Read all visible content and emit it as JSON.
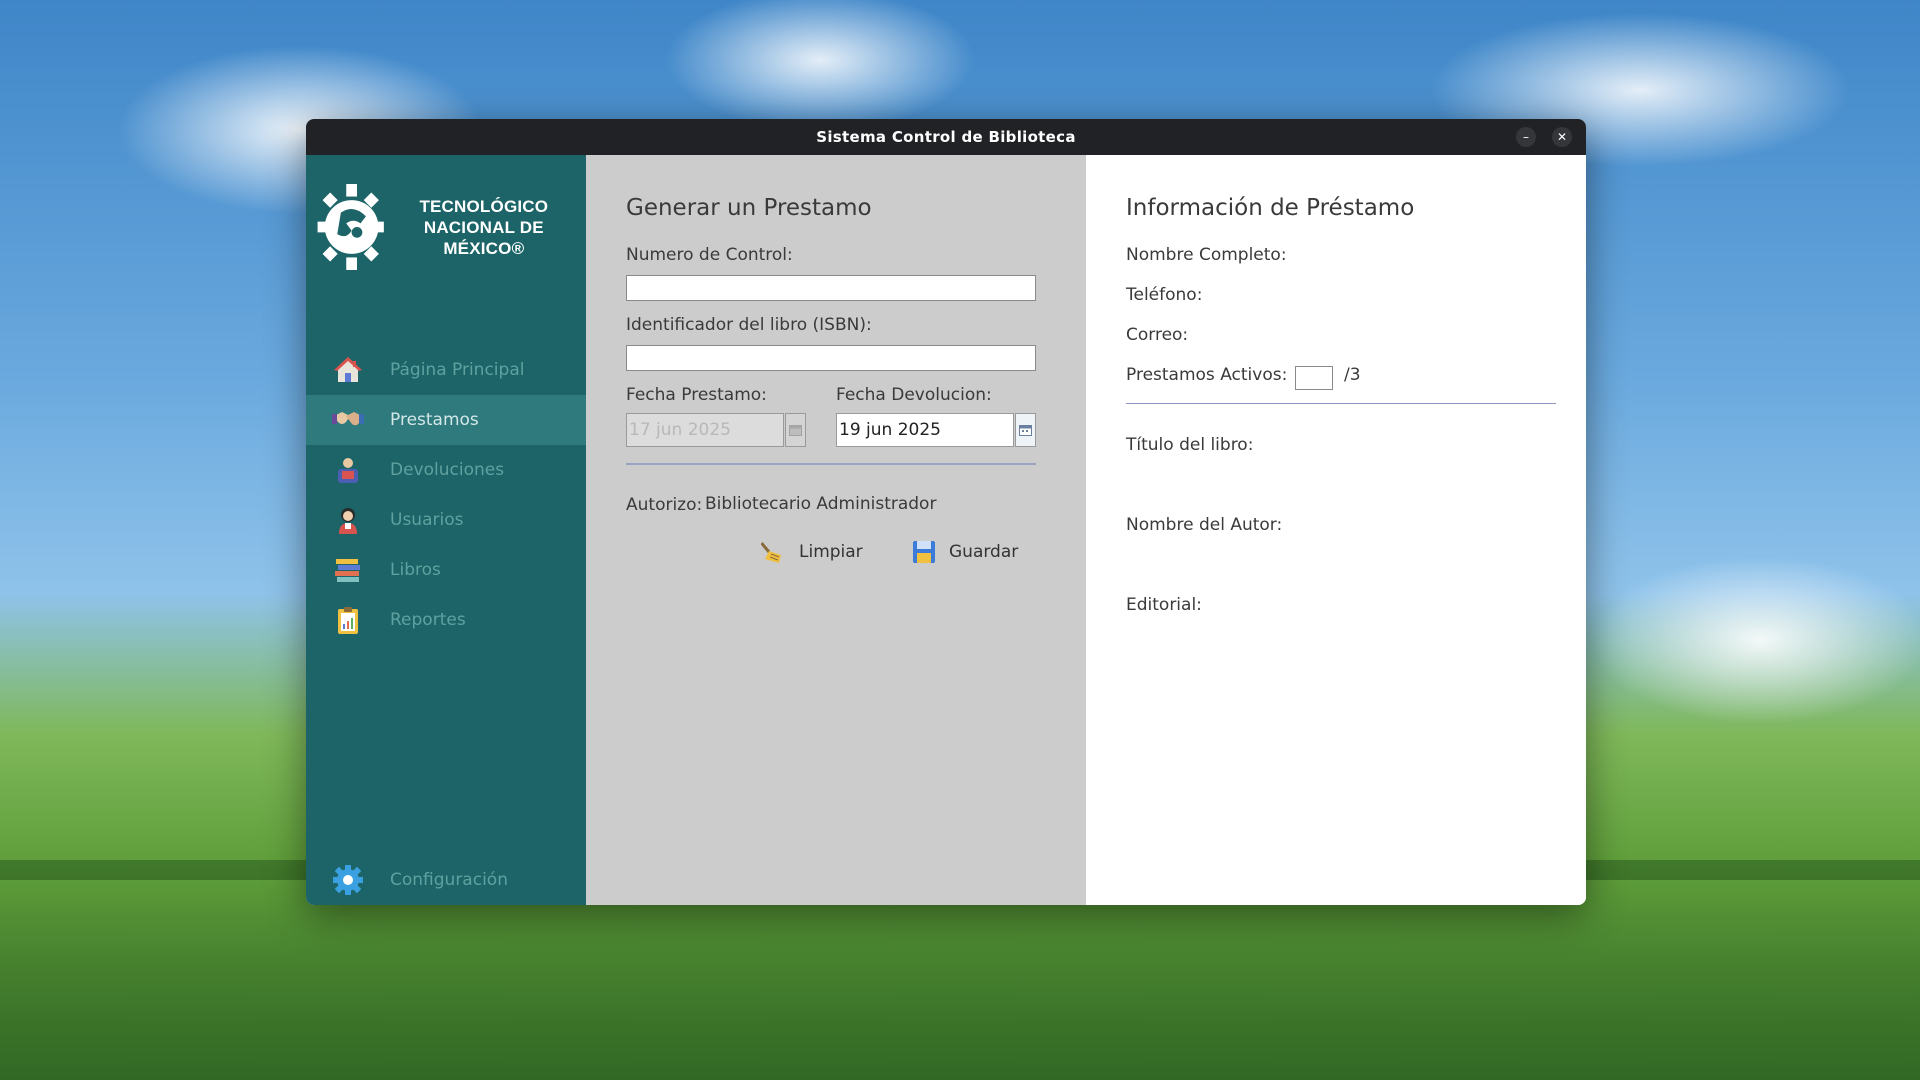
{
  "window": {
    "title": "Sistema Control de Biblioteca",
    "minimize": "–",
    "close": "✕"
  },
  "sidebar": {
    "logo_line1": "TECNOLÓGICO",
    "logo_line2": "NACIONAL DE MÉXICO®",
    "items": [
      {
        "label": "Página Principal",
        "icon": "house-icon",
        "active": false
      },
      {
        "label": "Prestamos",
        "icon": "handshake-icon",
        "active": true
      },
      {
        "label": "Devoluciones",
        "icon": "return-icon",
        "active": false
      },
      {
        "label": "Usuarios",
        "icon": "user-icon",
        "active": false
      },
      {
        "label": "Libros",
        "icon": "books-icon",
        "active": false
      },
      {
        "label": "Reportes",
        "icon": "clipboard-icon",
        "active": false
      }
    ],
    "config_label": "Configuración"
  },
  "form": {
    "title": "Generar un Prestamo",
    "control_label": "Numero de Control:",
    "control_value": "",
    "isbn_label": "Identificador del libro (ISBN):",
    "isbn_value": "",
    "fecha_prestamo_label": "Fecha Prestamo:",
    "fecha_prestamo_value": "17 jun 2025",
    "fecha_devolucion_label": "Fecha Devolucion:",
    "fecha_devolucion_value": "19 jun 2025",
    "autorizo_label": "Autorizo:",
    "autorizo_value": "Bibliotecario Administrador",
    "limpiar_label": "Limpiar",
    "guardar_label": "Guardar"
  },
  "info": {
    "title": "Información de Préstamo",
    "nombre_label": "Nombre Completo:",
    "telefono_label": "Teléfono:",
    "correo_label": "Correo:",
    "activos_label": "Prestamos Activos:",
    "activos_max": "/3",
    "titulo_label": "Título del libro:",
    "autor_label": "Nombre del Autor:",
    "editorial_label": "Editorial:"
  },
  "colors": {
    "sidebar": "#1c6467",
    "sidebar_active": "#2e7a7d",
    "form_bg": "#cccccc",
    "titlebar": "#202225"
  }
}
